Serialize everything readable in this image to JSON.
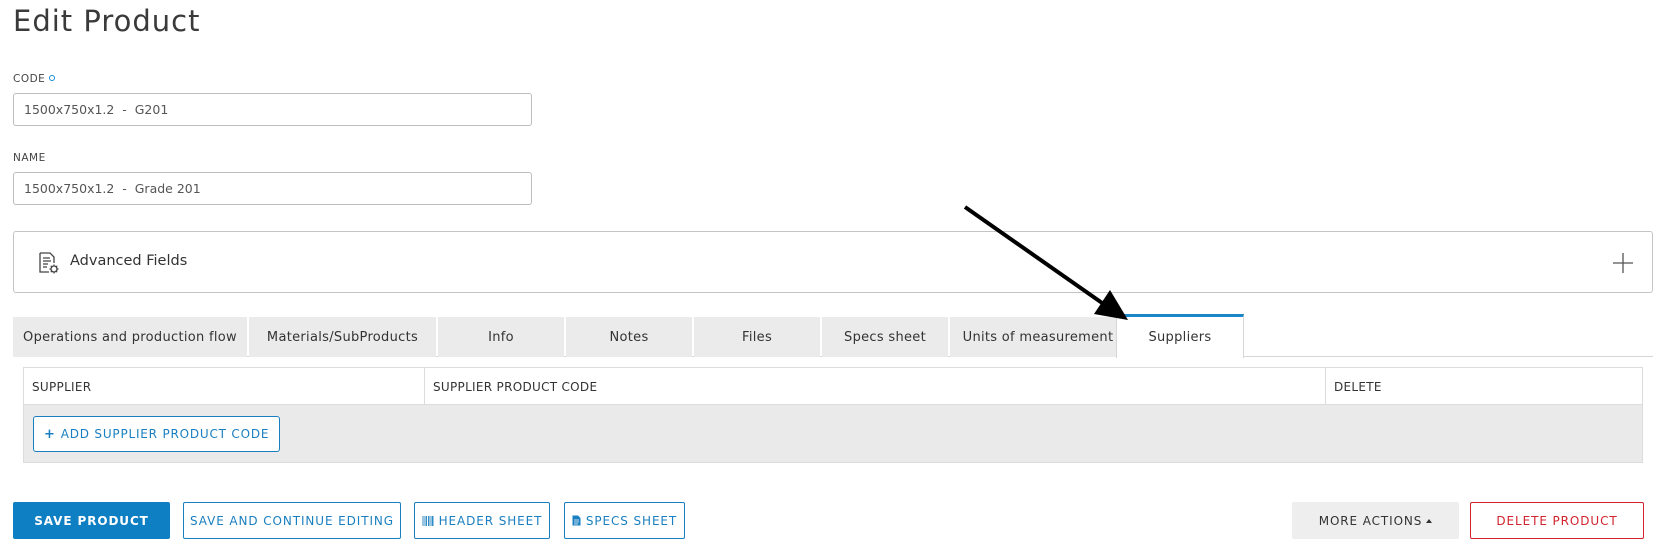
{
  "page": {
    "title": "Edit Product"
  },
  "form": {
    "code": {
      "label": "CODE",
      "value": "1500x750x1.2  -  G201"
    },
    "name": {
      "label": "NAME",
      "value": "1500x750x1.2  -  Grade 201"
    }
  },
  "advanced": {
    "title": "Advanced Fields",
    "icon": "document-settings-icon",
    "toggle_icon": "plus-icon"
  },
  "tabs": [
    {
      "label": "Operations and production flow"
    },
    {
      "label": "Materials/SubProducts"
    },
    {
      "label": "Info"
    },
    {
      "label": "Notes"
    },
    {
      "label": "Files"
    },
    {
      "label": "Specs sheet"
    },
    {
      "label": "Units of measurement"
    },
    {
      "label": "Suppliers",
      "active": true
    }
  ],
  "suppliers_table": {
    "columns": [
      "SUPPLIER",
      "SUPPLIER PRODUCT CODE",
      "DELETE"
    ],
    "rows": [],
    "add_button": "ADD SUPPLIER PRODUCT CODE"
  },
  "actions": {
    "save": "SAVE PRODUCT",
    "save_continue": "SAVE AND CONTINUE EDITING",
    "header_sheet": "HEADER SHEET",
    "specs_sheet": "SPECS SHEET",
    "more_actions": "MORE ACTIONS",
    "delete": "DELETE PRODUCT"
  },
  "colors": {
    "primary": "#0f7fc4",
    "danger": "#d2232f",
    "active_tab": "#1a86c8"
  }
}
